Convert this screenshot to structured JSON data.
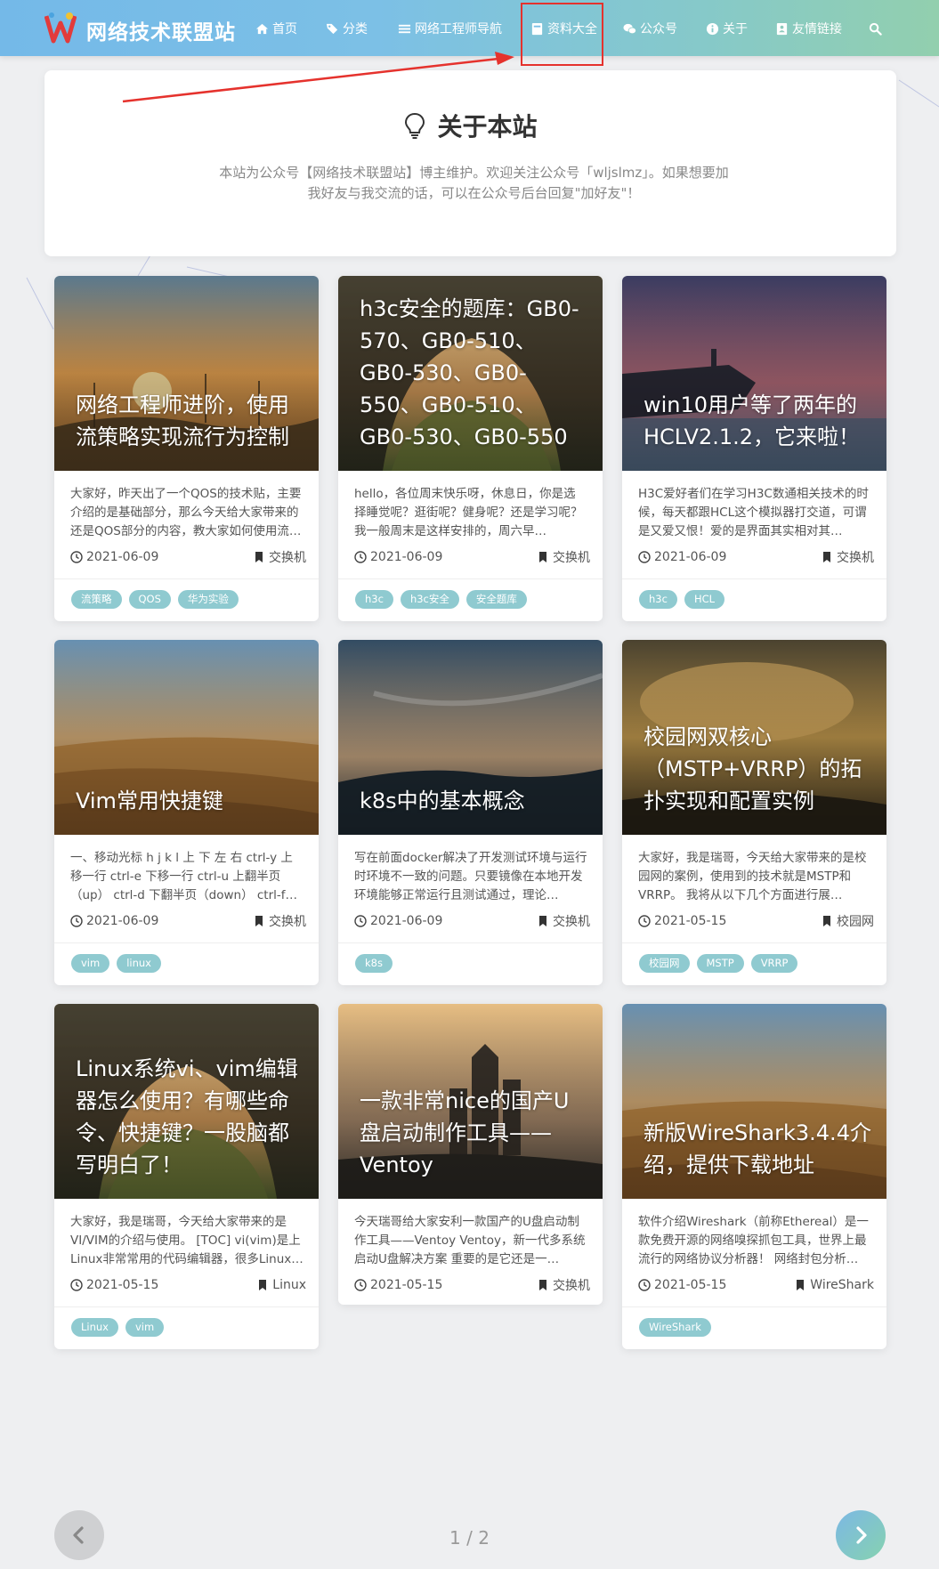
{
  "site": {
    "title": "网络技术联盟站"
  },
  "nav": [
    {
      "label": "首页",
      "icon": "home-icon"
    },
    {
      "label": "分类",
      "icon": "tags-icon"
    },
    {
      "label": "网络工程师导航",
      "icon": "list-icon"
    },
    {
      "label": "资料大全",
      "icon": "book-icon"
    },
    {
      "label": "公众号",
      "icon": "wechat-icon"
    },
    {
      "label": "关于",
      "icon": "info-icon"
    },
    {
      "label": "友情链接",
      "icon": "address-book-icon"
    }
  ],
  "about": {
    "title": "关于本站",
    "description": "本站为公众号【网络技术联盟站】博主维护。欢迎关注公众号「wljslmz」。如果想要加我好友与我交流的话，可以在公众号后台回复\"加好友\"！"
  },
  "posts": [
    {
      "title": "网络工程师进阶，使用流策略实现流行为控制",
      "excerpt": "大家好，昨天出了一个QOS的技术贴，主要介绍的是基础部分，那么今天给大家带来的还是QOS部分的内容，教大家如何使用流策略实现流行为控制…",
      "date": "2021-06-09",
      "category": "交换机",
      "tags": [
        "流策略",
        "QOS",
        "华为实验"
      ],
      "cover": "sunset"
    },
    {
      "title": "h3c安全的题库：GB0-570、GB0-510、GB0-530、GB0-550、GB0-510、GB0-530、GB0-550",
      "excerpt": "hello，各位周末快乐呀，休息日，你是选择睡觉呢？逛街呢？健身呢？还是学习呢？ 我一般周末是这样安排的，周六早…",
      "date": "2021-06-09",
      "category": "交换机",
      "tags": [
        "h3c",
        "h3c安全",
        "安全题库"
      ],
      "cover": "cave"
    },
    {
      "title": "win10用户等了两年的HCLV2.1.2，它来啦！",
      "excerpt": "H3C爱好者们在学习H3C数通相关技术的时候，每天都跟HCL这个模拟器打交道，可谓是又爱又恨！爱的是界面其实相对其…",
      "date": "2021-06-09",
      "category": "交换机",
      "tags": [
        "h3c",
        "HCL"
      ],
      "cover": "coast"
    },
    {
      "title": "Vim常用快捷键",
      "excerpt": "一、移动光标 h j k l 上 下 左 右 ctrl-y 上移一行 ctrl-e 下移一行 ctrl-u 上翻半页（up） ctrl-d 下翻半页（down） ctrl-f 上…",
      "date": "2021-06-09",
      "category": "交换机",
      "tags": [
        "vim",
        "linux"
      ],
      "cover": "desert"
    },
    {
      "title": "k8s中的基本概念",
      "excerpt": "写在前面docker解决了开发测试环境与运行时环境不一致的问题。只要镜像在本地开发环境能够正常运行且测试通过，理论…",
      "date": "2021-06-09",
      "category": "交换机",
      "tags": [
        "k8s"
      ],
      "cover": "sky"
    },
    {
      "title": "校园网双核心（MSTP+VRRP）的拓扑实现和配置实例",
      "excerpt": "大家好，我是瑞哥，今天给大家带来的是校园网的案例，使用到的技术就是MSTP和VRRP。 我将从以下几个方面进行展…",
      "date": "2021-05-15",
      "category": "校园网",
      "tags": [
        "校园网",
        "MSTP",
        "VRRP"
      ],
      "cover": "clouds"
    },
    {
      "title": "Linux系统vi、vim编辑器怎么使用？有哪些命令、快捷键？一股脑都写明白了！",
      "excerpt": "大家好，我是瑞哥，今天给大家带来的是VI/VIM的介绍与使用。 [TOC] vi(vim)是上Linux非常常用的代码编辑器，很多Linux…",
      "date": "2021-05-15",
      "category": "Linux",
      "tags": [
        "Linux",
        "vim"
      ],
      "cover": "cave"
    },
    {
      "title": "一款非常nice的国产U盘启动制作工具——Ventoy",
      "excerpt": "今天瑞哥给大家安利一款国产的U盘启动制作工具——Ventoy Ventoy，新一代多系统启动U盘解决方案 重要的是它还是一…",
      "date": "2021-05-15",
      "category": "交换机",
      "tags": [],
      "cover": "ruins"
    },
    {
      "title": "新版WireShark3.4.4介绍，提供下载地址",
      "excerpt": "软件介绍Wireshark（前称Ethereal）是一款免费开源的网络嗅探抓包工具，世界上最流行的网络协议分析器！ 网络封包分析…",
      "date": "2021-05-15",
      "category": "WireShark",
      "tags": [
        "WireShark"
      ],
      "cover": "desert"
    }
  ],
  "pagination": {
    "text": "1 / 2"
  },
  "colors": {
    "accent": "#7cc0e6",
    "tag": "#8fcad0",
    "highlight": "#e5322d"
  }
}
